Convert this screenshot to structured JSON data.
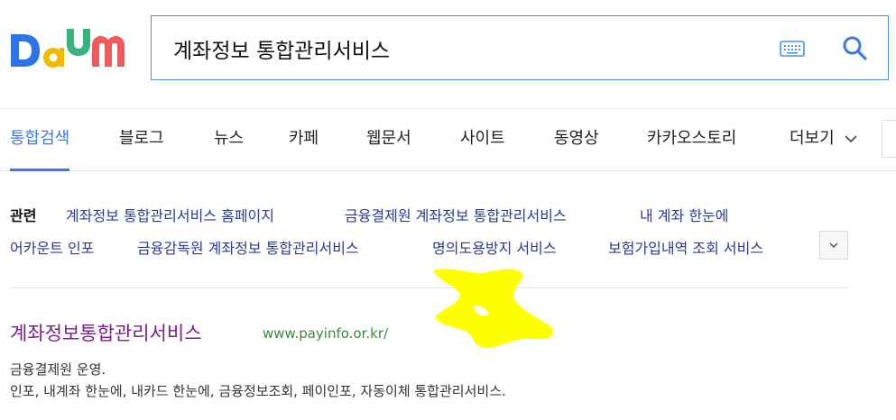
{
  "header": {
    "logo_text": "Daum",
    "search": {
      "value": "계좌정보 통합관리서비스",
      "placeholder": ""
    },
    "icons": {
      "keyboard": "keyboard-icon",
      "search": "search-icon"
    }
  },
  "tabs": [
    {
      "label": "통합검색",
      "active": true
    },
    {
      "label": "블로그",
      "active": false
    },
    {
      "label": "뉴스",
      "active": false
    },
    {
      "label": "카페",
      "active": false
    },
    {
      "label": "웹문서",
      "active": false
    },
    {
      "label": "사이트",
      "active": false
    },
    {
      "label": "동영상",
      "active": false
    },
    {
      "label": "카카오스토리",
      "active": false
    },
    {
      "label": "더보기",
      "active": false
    }
  ],
  "related": {
    "label": "관련",
    "links": [
      "계좌정보 통합관리서비스 홈페이지",
      "금융결제원 계좌정보 통합관리서비스",
      "내 계좌 한눈에",
      "어카운트 인포",
      "금융감독원 계좌정보 통합관리서비스",
      "명의도용방지 서비스",
      "보험가입내역 조회 서비스"
    ]
  },
  "result": {
    "title": "계좌정보통합관리서비스",
    "url": "www.payinfo.or.kr/",
    "desc1": "금융결제원 운영.",
    "desc2": "인포, 내계좌 한눈에, 내카드 한눈에, 금융정보조회, 페이인포, 자동이체 통합관리서비스."
  },
  "colors": {
    "accent": "#3d7ae5",
    "link": "#2a3b99",
    "visited_title": "#7e1d8f",
    "url": "#3a8a3a",
    "highlight_mark": "#ffff00"
  }
}
